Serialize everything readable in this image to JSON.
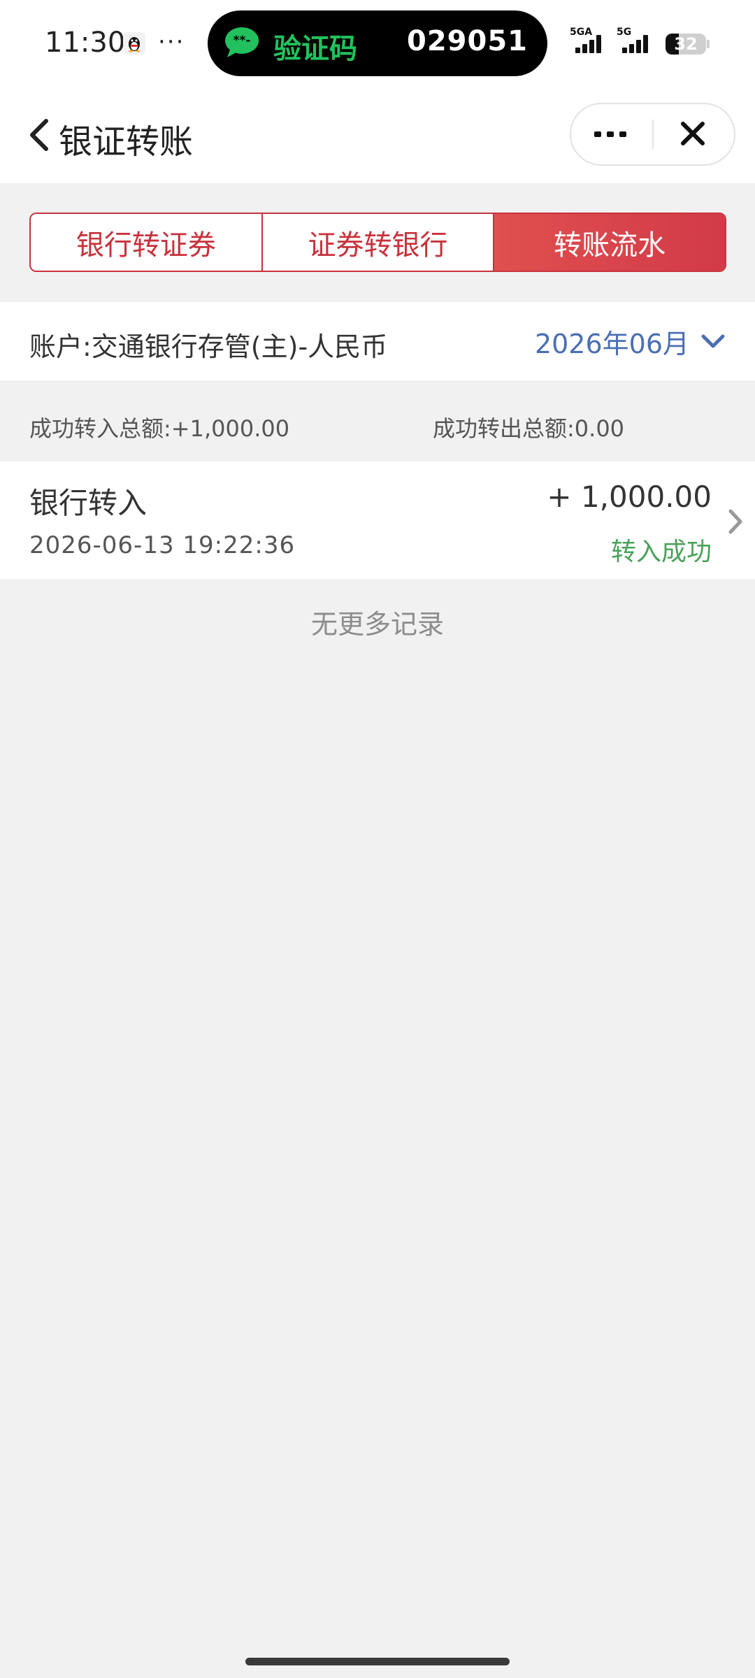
{
  "status_bar": {
    "time": "11:30",
    "more_dots": "···",
    "sms_label": "验证码",
    "sms_code": "029051",
    "sms_bubble_glyph": "**-",
    "signal1_tag": "5GA",
    "signal2_tag": "5G",
    "battery_level": "32",
    "battery_percent": 32,
    "accent_sms": "#22c15e"
  },
  "nav": {
    "title": "银证转账"
  },
  "tabs": [
    {
      "label": "银行转证券",
      "active": false
    },
    {
      "label": "证券转银行",
      "active": false
    },
    {
      "label": "转账流水",
      "active": true
    }
  ],
  "account": {
    "label": "账户:交通银行存管(主)-人民币",
    "month": "2026年06月"
  },
  "summary": {
    "in_total": "成功转入总额:+1,000.00",
    "out_total": "成功转出总额:0.00"
  },
  "records": [
    {
      "type": "银行转入",
      "time": "2026-06-13 19:22:36",
      "amount": "+ 1,000.00",
      "status": "转入成功"
    }
  ],
  "footer": {
    "no_more": "无更多记录"
  },
  "colors": {
    "brand_red": "#c8323c",
    "month_blue": "#4a6fb3",
    "success_green": "#4aa25a"
  }
}
